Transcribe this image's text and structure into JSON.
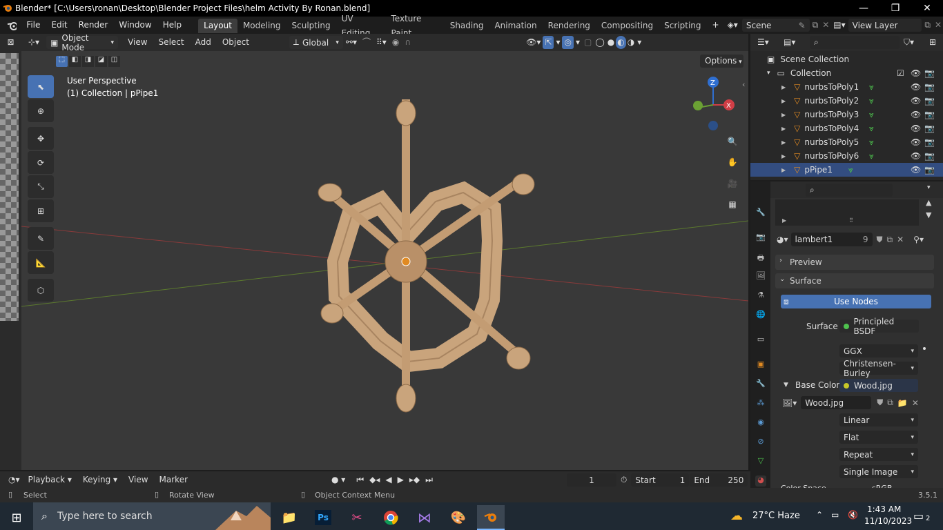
{
  "window": {
    "title": "Blender* [C:\\Users\\ronan\\Desktop\\Blender Project Files\\helm Activity By Ronan.blend]",
    "minimize": "—",
    "maximize": "❐",
    "close": "✕"
  },
  "menu": {
    "items": [
      "File",
      "Edit",
      "Render",
      "Window",
      "Help"
    ]
  },
  "workspaces": [
    "Layout",
    "Modeling",
    "Sculpting",
    "UV Editing",
    "Texture Paint",
    "Shading",
    "Animation",
    "Rendering",
    "Compositing",
    "Scripting"
  ],
  "scene": {
    "name": "Scene",
    "view_layer": "View Layer"
  },
  "viewport_header": {
    "mode": "Object Mode",
    "menus": [
      "View",
      "Select",
      "Add",
      "Object"
    ],
    "orientation": "Global",
    "options_label": "Options"
  },
  "viewport": {
    "view_name": "User Perspective",
    "collection_info": "(1) Collection | pPipe1",
    "gizmo_x": "X",
    "gizmo_y": "Y",
    "gizmo_z": "Z"
  },
  "outliner": {
    "root": "Scene Collection",
    "collection": "Collection",
    "items": [
      {
        "name": "nurbsToPoly1",
        "selected": false
      },
      {
        "name": "nurbsToPoly2",
        "selected": false
      },
      {
        "name": "nurbsToPoly3",
        "selected": false
      },
      {
        "name": "nurbsToPoly4",
        "selected": false
      },
      {
        "name": "nurbsToPoly5",
        "selected": false
      },
      {
        "name": "nurbsToPoly6",
        "selected": false
      },
      {
        "name": "pPipe1",
        "selected": true
      }
    ]
  },
  "material": {
    "name": "lambert1",
    "users": "9",
    "preview_label": "Preview",
    "surface_panel": "Surface",
    "use_nodes": "Use Nodes",
    "surface_label": "Surface",
    "surface_shader": "Principled BSDF",
    "distribution": "GGX",
    "subsurface": "Christensen-Burley",
    "base_color_label": "Base Color",
    "base_color_texture": "Wood.jpg",
    "image_name": "Wood.jpg",
    "interpolation": "Linear",
    "projection": "Flat",
    "extension": "Repeat",
    "source": "Single Image",
    "color_space_partial": "Color Space",
    "color_space_value": "sRGB"
  },
  "timeline": {
    "menus": [
      "Playback",
      "Keying",
      "View",
      "Marker"
    ],
    "current_frame": "1",
    "start_label": "Start",
    "start": "1",
    "end_label": "End",
    "end": "250"
  },
  "status": {
    "select": "Select",
    "rotate": "Rotate View",
    "context": "Object Context Menu",
    "version": "3.5.1"
  },
  "taskbar": {
    "search_placeholder": "Type here to search",
    "weather": "27°C  Haze",
    "time": "1:43 AM",
    "date": "11/10/2023",
    "notifications": "2"
  }
}
